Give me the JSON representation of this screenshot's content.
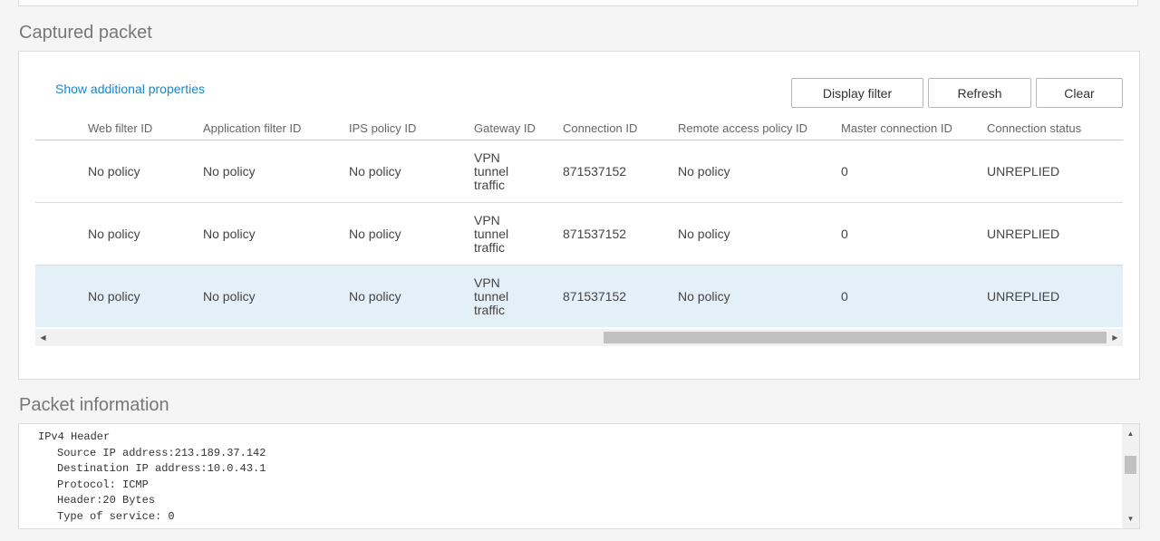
{
  "sections": {
    "captured_title": "Captured packet",
    "packet_title": "Packet information"
  },
  "captured": {
    "show_props_link": "Show additional properties",
    "buttons": {
      "display_filter": "Display filter",
      "refresh": "Refresh",
      "clear": "Clear"
    },
    "columns": [
      "Web filter ID",
      "Application filter ID",
      "IPS policy ID",
      "Gateway ID",
      "Connection ID",
      "Remote access policy ID",
      "Master connection ID",
      "Connection status"
    ],
    "rows": [
      {
        "web_filter": "No policy",
        "app_filter": "No policy",
        "ips_policy": "No policy",
        "gateway": [
          "VPN",
          "tunnel",
          "traffic"
        ],
        "connection_id": "871537152",
        "remote_access": "No policy",
        "master_connection": "0",
        "status": "UNREPLIED",
        "selected": false
      },
      {
        "web_filter": "No policy",
        "app_filter": "No policy",
        "ips_policy": "No policy",
        "gateway": [
          "VPN",
          "tunnel",
          "traffic"
        ],
        "connection_id": "871537152",
        "remote_access": "No policy",
        "master_connection": "0",
        "status": "UNREPLIED",
        "selected": false
      },
      {
        "web_filter": "No policy",
        "app_filter": "No policy",
        "ips_policy": "No policy",
        "gateway": [
          "VPN",
          "tunnel",
          "traffic"
        ],
        "connection_id": "871537152",
        "remote_access": "No policy",
        "master_connection": "0",
        "status": "UNREPLIED",
        "selected": true
      }
    ]
  },
  "packet_info": {
    "header": "IPv4 Header",
    "lines": [
      "Source IP address:213.189.37.142",
      "Destination IP address:10.0.43.1",
      "Protocol: ICMP",
      "Header:20 Bytes",
      "Type of service: 0"
    ]
  },
  "icons": {
    "scroll_left": "triangle-left-icon",
    "scroll_right": "triangle-right-icon",
    "scroll_up": "triangle-up-icon",
    "scroll_down": "triangle-down-icon"
  },
  "colors": {
    "link": "#1a87c9",
    "selected_row_bg": "#e4f0f7",
    "selected_row_border": "#3a8fc4"
  }
}
